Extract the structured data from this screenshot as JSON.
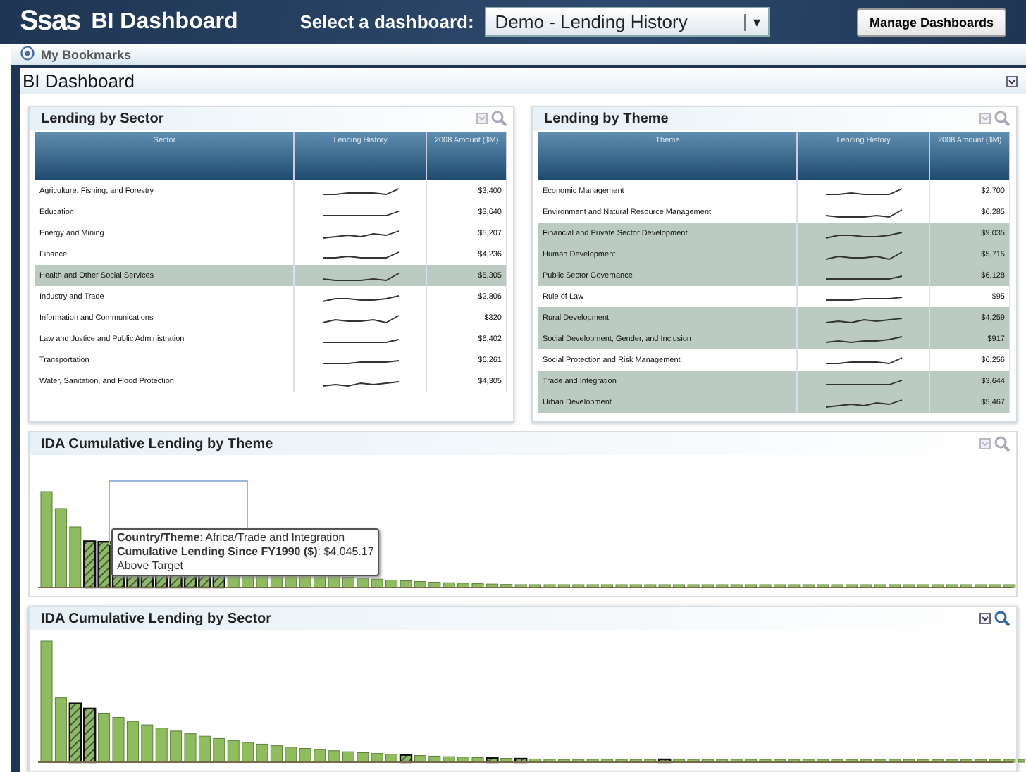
{
  "header": {
    "logo": "Ssas",
    "title": "BI Dashboard",
    "select_label": "Select a dashboard:",
    "select_value": "Demo - Lending History",
    "dropdown_caret": "▾",
    "manage_button": "Manage Dashboards"
  },
  "bookmarks": {
    "icon": "⦿",
    "label": "My Bookmarks"
  },
  "page_title": "BI Dashboard",
  "sector_table": {
    "title": "Lending by Sector",
    "columns": [
      "Sector",
      "Lending History",
      "2008 Amount ($M)"
    ],
    "rows": [
      {
        "name": "Agriculture, Fishing, and Forestry",
        "amount": "$3,400",
        "selected": false
      },
      {
        "name": "Education",
        "amount": "$3,640",
        "selected": false
      },
      {
        "name": "Energy and Mining",
        "amount": "$5,207",
        "selected": false
      },
      {
        "name": "Finance",
        "amount": "$4,236",
        "selected": false
      },
      {
        "name": "Health and Other Social Services",
        "amount": "$5,305",
        "selected": true
      },
      {
        "name": "Industry and Trade",
        "amount": "$2,806",
        "selected": false
      },
      {
        "name": "Information and Communications",
        "amount": "$320",
        "selected": false
      },
      {
        "name": "Law and Justice and Public Administration",
        "amount": "$6,402",
        "selected": false
      },
      {
        "name": "Transportation",
        "amount": "$6,261",
        "selected": false
      },
      {
        "name": "Water, Sanitation, and Flood Protection",
        "amount": "$4,305",
        "selected": false
      }
    ]
  },
  "theme_table": {
    "title": "Lending by Theme",
    "columns": [
      "Theme",
      "Lending History",
      "2008 Amount ($M)"
    ],
    "rows": [
      {
        "name": "Economic Management",
        "amount": "$2,700",
        "selected": false
      },
      {
        "name": "Environment and Natural Resource Management",
        "amount": "$6,285",
        "selected": false
      },
      {
        "name": "Financial and Private Sector Development",
        "amount": "$9,035",
        "selected": true
      },
      {
        "name": "Human Development",
        "amount": "$5,715",
        "selected": true
      },
      {
        "name": "Public Sector Governance",
        "amount": "$6,128",
        "selected": true
      },
      {
        "name": "Rule of Law",
        "amount": "$95",
        "selected": false
      },
      {
        "name": "Rural Development",
        "amount": "$4,259",
        "selected": true
      },
      {
        "name": "Social Development, Gender, and Inclusion",
        "amount": "$917",
        "selected": true
      },
      {
        "name": "Social Protection and Risk Management",
        "amount": "$6,256",
        "selected": false
      },
      {
        "name": "Trade and Integration",
        "amount": "$3,644",
        "selected": true
      },
      {
        "name": "Urban Development",
        "amount": "$5,467",
        "selected": true
      }
    ]
  },
  "theme_chart": {
    "title": "IDA Cumulative Lending by Theme",
    "tooltip": {
      "line_1": "**Country/Theme**: Africa/Trade and Integration",
      "line_2": "**Cumulative Lending Since FY1990 ($)**: $4,045.17",
      "line_3": "Above Target"
    }
  },
  "sector_chart": {
    "title": "IDA Cumulative Lending by Sector"
  }
}
